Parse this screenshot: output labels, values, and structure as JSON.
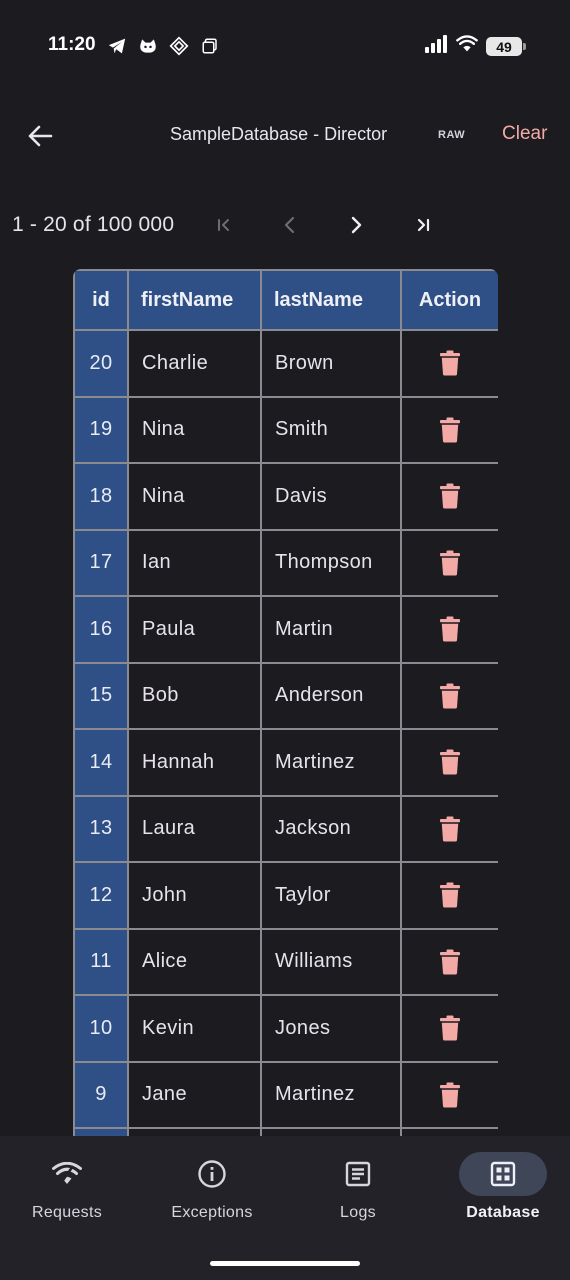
{
  "status_bar": {
    "time": "11:20",
    "battery": "49"
  },
  "app_bar": {
    "title": "SampleDatabase - Director",
    "raw_label": "RAW",
    "clear_label": "Clear"
  },
  "pagination": {
    "range_text": "1 - 20 of 100 000"
  },
  "table": {
    "headers": [
      "id",
      "firstName",
      "lastName",
      "Action"
    ],
    "rows": [
      {
        "id": "20",
        "firstName": "Charlie",
        "lastName": "Brown"
      },
      {
        "id": "19",
        "firstName": "Nina",
        "lastName": "Smith"
      },
      {
        "id": "18",
        "firstName": "Nina",
        "lastName": "Davis"
      },
      {
        "id": "17",
        "firstName": "Ian",
        "lastName": "Thompson"
      },
      {
        "id": "16",
        "firstName": "Paula",
        "lastName": "Martin"
      },
      {
        "id": "15",
        "firstName": "Bob",
        "lastName": "Anderson"
      },
      {
        "id": "14",
        "firstName": "Hannah",
        "lastName": "Martinez"
      },
      {
        "id": "13",
        "firstName": "Laura",
        "lastName": "Jackson"
      },
      {
        "id": "12",
        "firstName": "John",
        "lastName": "Taylor"
      },
      {
        "id": "11",
        "firstName": "Alice",
        "lastName": "Williams"
      },
      {
        "id": "10",
        "firstName": "Kevin",
        "lastName": "Jones"
      },
      {
        "id": "9",
        "firstName": "Jane",
        "lastName": "Martinez"
      },
      {
        "id": "",
        "firstName": "",
        "lastName": ""
      }
    ],
    "action_icon": "trash-icon"
  },
  "bottom_nav": {
    "items": [
      {
        "label": "Requests",
        "icon": "wifi-icon"
      },
      {
        "label": "Exceptions",
        "icon": "info-icon"
      },
      {
        "label": "Logs",
        "icon": "logs-icon"
      },
      {
        "label": "Database",
        "icon": "database-grid-icon"
      }
    ],
    "active": "Database"
  },
  "colors": {
    "background": "#1c1b20",
    "header_blue": "#2f4f87",
    "accent_pink": "#f3aaa7",
    "nav_active_pill": "#3f4658"
  }
}
